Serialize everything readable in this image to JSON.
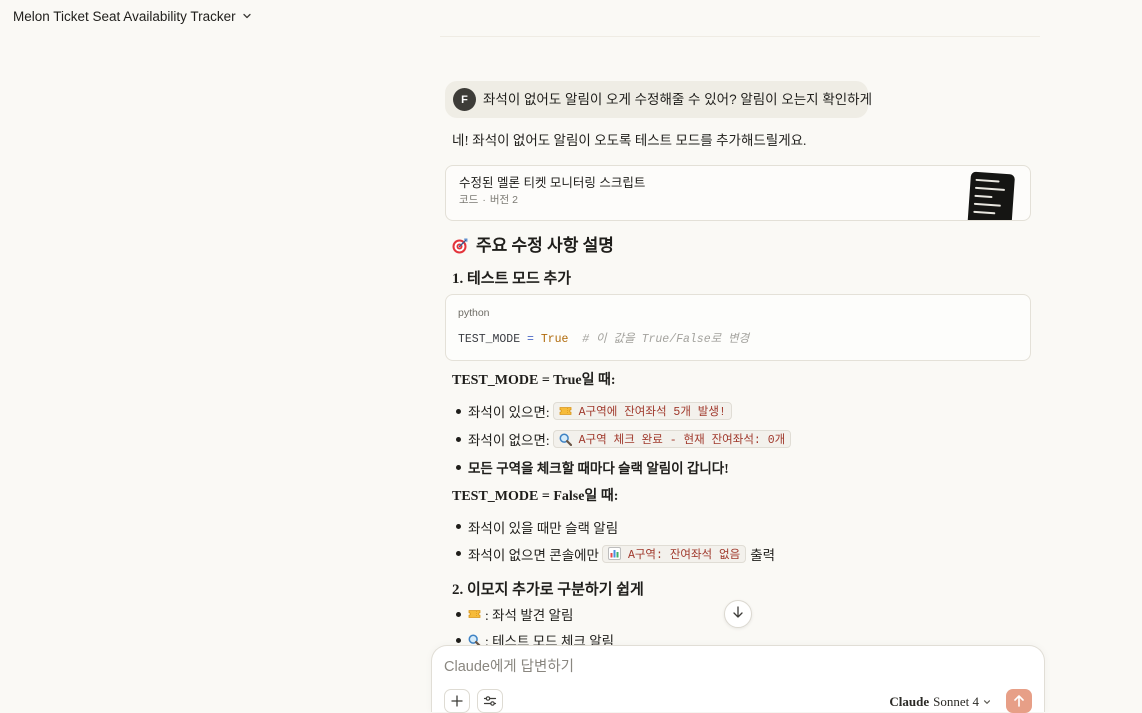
{
  "header": {
    "title": "Melon Ticket Seat Availability Tracker",
    "menu_icon": "chevron-down-icon"
  },
  "user_message": {
    "avatar_initial": "F",
    "text": "좌석이 없어도 알림이 오게 수정해줄 수 있어? 알림이 오는지 확인하게"
  },
  "assistant": {
    "intro": "네! 좌석이 없어도 알림이 오도록 테스트 모드를 추가해드릴게요.",
    "artifact": {
      "title": "수정된 멜론 티켓 모니터링 스크립트",
      "kind": "코드",
      "separator": "·",
      "version": "버전 2"
    },
    "summary_heading": {
      "icon": "target-icon",
      "text": "주요 수정 사항 설명"
    },
    "section_1": {
      "heading": "1. 테스트 모드 추가",
      "code_block": {
        "language": "python",
        "tokens": [
          {
            "text": "TEST_MODE",
            "kind": "name"
          },
          {
            "text": " = ",
            "kind": "operator"
          },
          {
            "text": "True",
            "kind": "constant"
          },
          {
            "text": "  # 이 값을 True/False로 변경",
            "kind": "comment"
          }
        ]
      },
      "true_mode": {
        "label": "TEST_MODE = True일 때:",
        "items": [
          {
            "text": "좌석이 있으면:",
            "code_icon": "ticket-icon",
            "code": "A구역에 잔여좌석 5개 발생!"
          },
          {
            "text": "좌석이 없으면:",
            "code_icon": "magnifier-icon",
            "code": "A구역 체크 완료 - 현재 잔여좌석: 0개"
          },
          {
            "text": "모든 구역을 체크할 때마다 슬랙 알림이 갑니다!",
            "bold": true
          }
        ]
      },
      "false_mode": {
        "label": "TEST_MODE = False일 때:",
        "items": [
          {
            "text": "좌석이 있을 때만 슬랙 알림"
          },
          {
            "text": "좌석이 없으면 콘솔에만",
            "code_icon": "bar-chart-icon",
            "code": "A구역: 잔여좌석 없음",
            "suffix": "출력"
          }
        ]
      }
    },
    "section_2": {
      "heading": "2. 이모지 추가로 구분하기 쉽게",
      "items": [
        {
          "icon": "ticket-icon",
          "text": ": 좌석 발견 알림"
        },
        {
          "icon": "magnifier-icon",
          "text": ": 테스트 모드 체크 알림"
        }
      ]
    }
  },
  "scroll_button": {
    "icon": "arrow-down-icon"
  },
  "composer": {
    "placeholder": "Claude에게 답변하기",
    "add_icon": "plus-icon",
    "tools_icon": "sliders-icon",
    "model": {
      "brand": "Claude",
      "name": "Sonnet 4",
      "icon": "chevron-down-icon"
    },
    "send_icon": "arrow-up-icon"
  },
  "colors": {
    "background": "#faf9f5",
    "user_bubble": "#efede5",
    "send_button": "#e79f87",
    "inline_code_text": "#a0392c",
    "code_constant": "#b06a0a",
    "code_operator": "#4b69c6"
  }
}
